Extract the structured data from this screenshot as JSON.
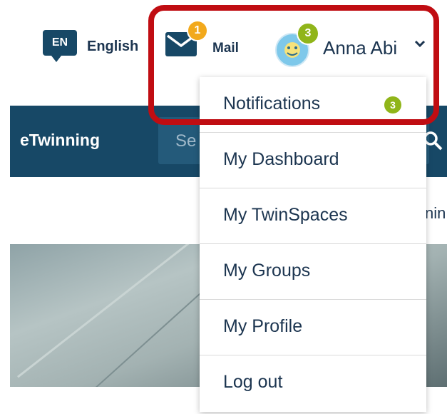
{
  "topbar": {
    "lang_code": "EN",
    "lang_label": "English",
    "mail_label": "Mail",
    "mail_count": "1",
    "user_name": "Anna Abi",
    "user_count": "3"
  },
  "site": {
    "title": "eTwinning",
    "search_placeholder": "Se",
    "partial_text": "nin"
  },
  "menu": {
    "items": [
      {
        "label": "Notifications",
        "count": "3"
      },
      {
        "label": "My Dashboard"
      },
      {
        "label": "My TwinSpaces"
      },
      {
        "label": "My Groups"
      },
      {
        "label": "My Profile"
      },
      {
        "label": "Log out"
      }
    ]
  },
  "colors": {
    "navy": "#174866",
    "badge_green": "#90b51a",
    "badge_orange": "#f2a91c",
    "highlight_red": "#c00d12"
  },
  "icons": [
    "language-icon",
    "mail-icon",
    "avatar",
    "chevron-down-icon",
    "search-icon"
  ]
}
